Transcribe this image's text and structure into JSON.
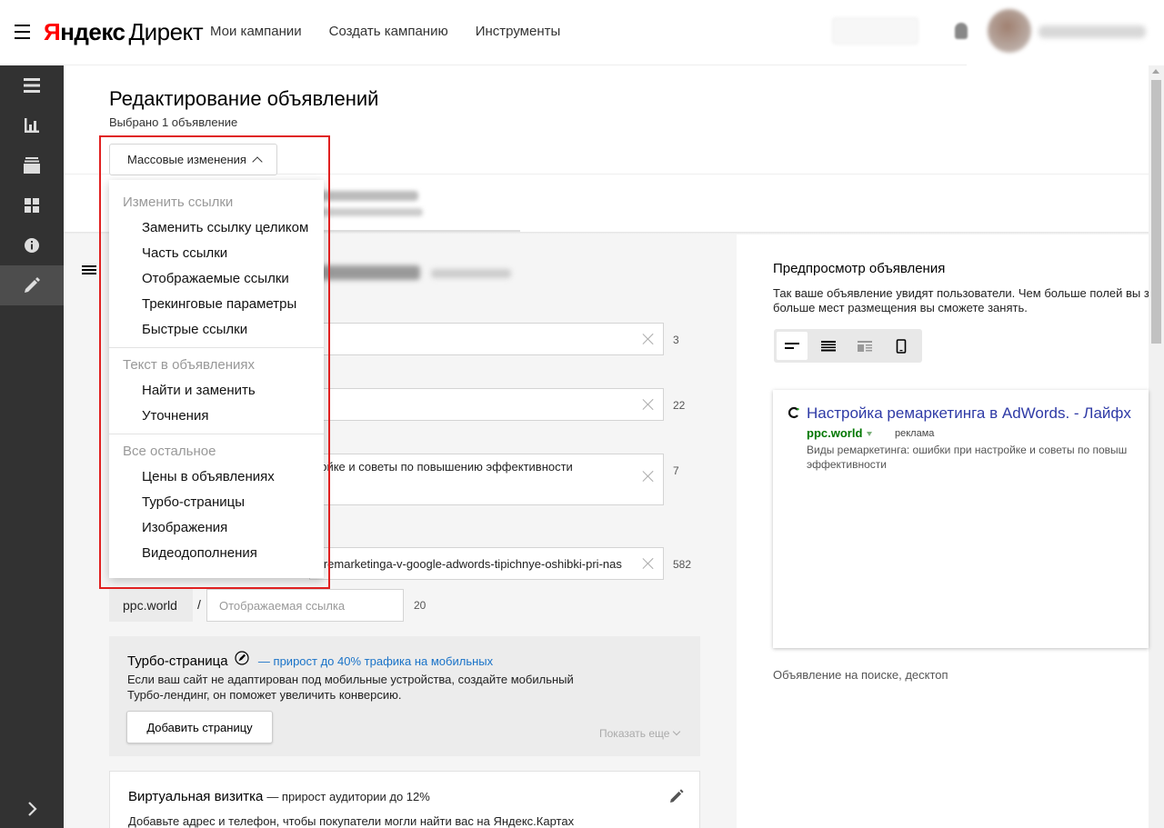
{
  "header": {
    "logo_ya": "Яндекс",
    "logo_direct": "Директ",
    "nav": [
      "Мои кампании",
      "Создать кампанию",
      "Инструменты"
    ]
  },
  "sidebar": {
    "items": [
      "menu-icon",
      "stats-icon",
      "layers-icon",
      "grid-icon",
      "info-icon",
      "edit-icon"
    ],
    "active": "edit-icon",
    "expand": "chevron-right-icon"
  },
  "page": {
    "title": "Редактирование объявлений",
    "selected": "Выбрано 1 объявление",
    "mass_button": "Массовые изменения"
  },
  "dropdown": {
    "groups": [
      {
        "label": "Изменить ссылки",
        "items": [
          "Заменить ссылку целиком",
          "Часть ссылки",
          "Отображаемые ссылки",
          "Трекинговые параметры",
          "Быстрые ссылки"
        ]
      },
      {
        "label": "Текст в объявлениях",
        "items": [
          "Найти и заменить",
          "Уточнения"
        ]
      },
      {
        "label": "Все остальное",
        "items": [
          "Цены в объявлениях",
          "Турбо-страницы",
          "Изображения",
          "Видеодополнения"
        ]
      }
    ]
  },
  "form": {
    "fields": [
      {
        "value": "",
        "count": "3"
      },
      {
        "value": "",
        "count": "22"
      },
      {
        "value": "ройке и советы по повышению эффективности",
        "count": "7"
      },
      {
        "value": "y-remarketinga-v-google-adwords-tipichnye-oshibki-pri-nas",
        "count": "582"
      }
    ],
    "domain": "ppc.world",
    "slash": "/",
    "display_link_placeholder": "Отображаемая ссылка",
    "display_link_count": "20"
  },
  "turbo": {
    "title": "Турбо-страница",
    "link": "— прирост до 40% трафика на мобильных",
    "desc": "Если ваш сайт не адаптирован под мобильные устройства, создайте мобильный Турбо-лендинг, он поможет увеличить конверсию.",
    "button": "Добавить страницу",
    "more": "Показать еще"
  },
  "vcard": {
    "title": "Виртуальная визитка",
    "sub": "— прирост аудитории до 12%",
    "desc": "Добавьте адрес и телефон, чтобы покупатели могли найти вас на Яндекс.Картах"
  },
  "preview": {
    "title": "Предпросмотр объявления",
    "desc_line1": "Так ваше объявление увидят пользователи. Чем больше полей вы за",
    "desc_line2": "больше мест размещения вы сможете занять.",
    "ad": {
      "title": "Настройка ремаркетинга в AdWords. - Лайфх",
      "url": "ppc.world",
      "label": "реклама",
      "text": "Виды ремаркетинга: ошибки при настройке и советы по повыш эффективности"
    },
    "caption": "Объявление на поиске, десктоп"
  },
  "colors": {
    "sidebar": "#323232",
    "highlight_frame": "#e02020",
    "ad_title": "#2e3aa6",
    "ad_url": "#007700",
    "turbo_link": "#1a73c8"
  }
}
